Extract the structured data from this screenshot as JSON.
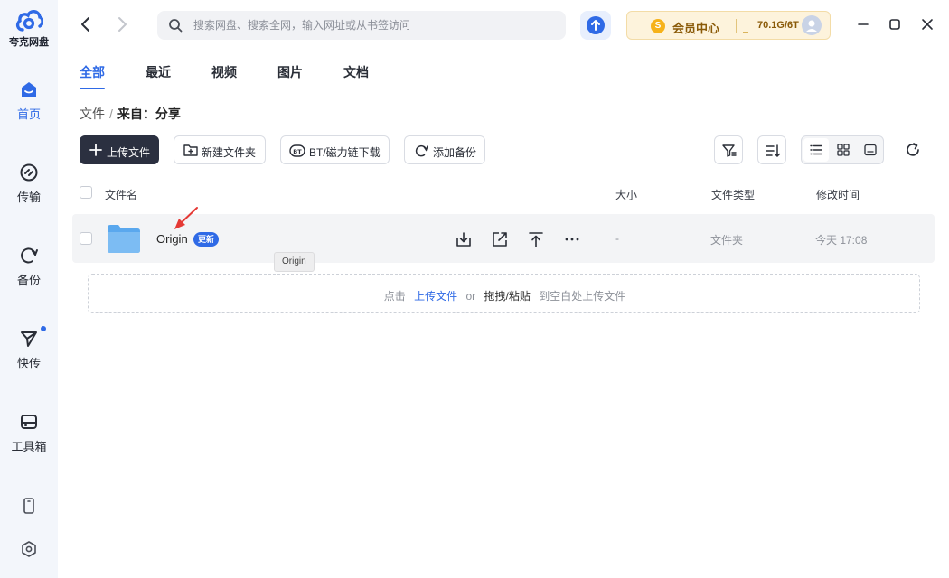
{
  "app": {
    "name": "夸克网盘"
  },
  "sidebar": {
    "items": [
      {
        "label": "首页",
        "icon": "home-icon",
        "active": true
      },
      {
        "label": "传输",
        "icon": "transfer-icon"
      },
      {
        "label": "备份",
        "icon": "backup-icon"
      },
      {
        "label": "快传",
        "icon": "send-icon",
        "has_notification": true
      },
      {
        "label": "工具箱",
        "icon": "toolbox-icon"
      }
    ],
    "bottom_icons": [
      "phone-icon",
      "settings-icon"
    ]
  },
  "topbar": {
    "search_placeholder": "搜索网盘、搜索全网，输入网址或从书签访问",
    "vip": {
      "coin": "S",
      "label": "会员中心",
      "storage": "70.1G/6T"
    }
  },
  "tabs": [
    "全部",
    "最近",
    "视频",
    "图片",
    "文档"
  ],
  "breadcrumb": {
    "root": "文件",
    "separator": "/",
    "current": "来自：分享"
  },
  "toolbar": {
    "upload": "上传文件",
    "new_folder": "新建文件夹",
    "bt_download": "BT/磁力链下载",
    "add_backup": "添加备份"
  },
  "table": {
    "columns": {
      "name": "文件名",
      "size": "大小",
      "type": "文件类型",
      "modified": "修改时间"
    },
    "rows": [
      {
        "name": "Origin",
        "badge": "更新",
        "size": "-",
        "type": "文件夹",
        "modified": "今天 17:08"
      }
    ]
  },
  "tooltip": "Origin",
  "dropzone": {
    "prefix": "点击",
    "link": "上传文件",
    "or": "or",
    "drag": "拖拽/粘贴",
    "suffix": "到空白处上传文件"
  },
  "colors": {
    "accent": "#2f6ae6",
    "annotation": "#e53935",
    "primary_button": "#2b3040",
    "vip_bg": "#fdf3dc"
  }
}
